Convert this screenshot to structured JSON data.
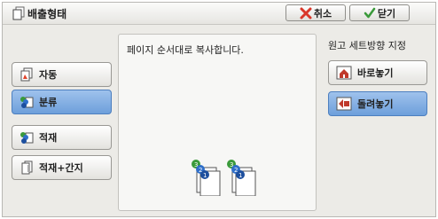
{
  "window": {
    "title": "배출형태"
  },
  "toolbar": {
    "cancel_label": "취소",
    "close_label": "닫기"
  },
  "output_modes": [
    {
      "label": "자동",
      "icon": "auto-icon",
      "selected": false
    },
    {
      "label": "분류",
      "icon": "collate-icon",
      "selected": true
    },
    {
      "label": "적재",
      "icon": "stack-icon",
      "selected": false
    },
    {
      "label": "적재+간지",
      "icon": "stack-separator-icon",
      "selected": false
    }
  ],
  "preview": {
    "message": "페이지 순서대로 복사합니다."
  },
  "orientation": {
    "label": "원고 세트방향 지정",
    "options": [
      {
        "label": "바로놓기",
        "icon": "upright-icon",
        "selected": false
      },
      {
        "label": "돌려놓기",
        "icon": "rotated-icon",
        "selected": true
      }
    ]
  },
  "colors": {
    "selected": "#7aa8e0",
    "cancel_x": "#d9372a",
    "close_check": "#3a9a3a"
  }
}
